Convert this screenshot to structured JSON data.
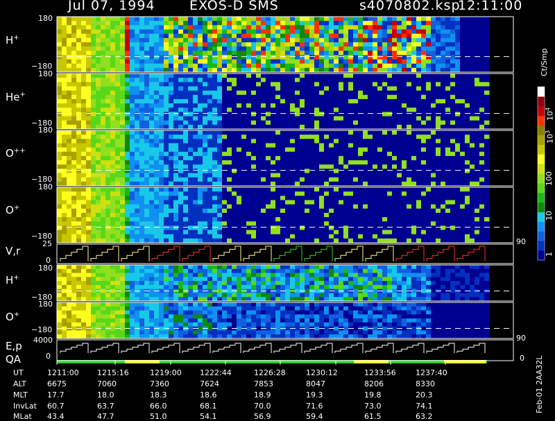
{
  "header": {
    "date": "Jul 07, 1994",
    "instrument": "EXOS-D SMS",
    "file": "s4070802.ksp",
    "time": "12:11:00"
  },
  "colors": {
    "palette": [
      "#000090",
      "#0030c0",
      "#1060e0",
      "#1090f0",
      "#18c8e8",
      "#108808",
      "#18b818",
      "#58d818",
      "#90e020",
      "#d0e010",
      "#ffff20",
      "#c8c800",
      "#a8a000",
      "#888000",
      "#ff3000",
      "#c80000",
      "#900010",
      "#ffffff"
    ]
  },
  "panels": [
    {
      "id": "H+",
      "base": "H",
      "sup": "+",
      "ytop": "180",
      "ybot": "−180"
    },
    {
      "id": "He+",
      "base": "He",
      "sup": "+",
      "ytop": "180",
      "ybot": "−180"
    },
    {
      "id": "O++",
      "base": "O",
      "sup": "++",
      "ytop": "180",
      "ybot": "−180"
    },
    {
      "id": "O+",
      "base": "O",
      "sup": "+",
      "ytop": "180",
      "ybot": "−180"
    },
    {
      "id": "Vr",
      "label": "V,r",
      "ytop": "25",
      "ybot": "0",
      "right": "90"
    },
    {
      "id": "H+2",
      "base": "H",
      "sup": "+",
      "ytop": "180",
      "ybot": "−180"
    },
    {
      "id": "O+2",
      "base": "O",
      "sup": "+",
      "ytop": "180",
      "ybot": "−180"
    },
    {
      "id": "Ep",
      "label": "E,p",
      "ytop": "4000",
      "ybot": "0",
      "right_top": "90",
      "right_bot": "0"
    }
  ],
  "qa_label": "QA",
  "colorbar": {
    "unit": "Ct/Smp",
    "tick_1e4_base": "10",
    "tick_1e4_exp": "4",
    "tick_1e3_base": "10",
    "tick_1e3_exp": "3",
    "tick_100": "100",
    "tick_10": "10",
    "tick_1": "1"
  },
  "footer": {
    "rows": [
      {
        "label": "UT",
        "values": [
          "1211:00",
          "1215:16",
          "1219:00",
          "1222:44",
          "1226:28",
          "1230:12",
          "1233:56",
          "1237:40"
        ]
      },
      {
        "label": "ALT",
        "values": [
          "6675",
          "7060",
          "7360",
          "7624",
          "7853",
          "8047",
          "8206",
          "8330"
        ]
      },
      {
        "label": "MLT",
        "values": [
          "17.7",
          "18.0",
          "18.3",
          "18.6",
          "18.9",
          "19.3",
          "19.8",
          "20.3"
        ]
      },
      {
        "label": "InvLat",
        "values": [
          "60.7",
          "63.7",
          "66.0",
          "68.1",
          "70.0",
          "71.6",
          "73.0",
          "74.1"
        ]
      },
      {
        "label": "MLat",
        "values": [
          "43.4",
          "47.7",
          "51.0",
          "54.1",
          "56.9",
          "59.4",
          "61.5",
          "63.2"
        ]
      }
    ],
    "code": "Feb-01 2AA32L"
  },
  "chart_data": {
    "type": "heatmap",
    "title": "Jul 07, 1994   EXOS-D SMS",
    "xlabel": "UT",
    "x_ticks": [
      "1211:00",
      "1215:16",
      "1219:00",
      "1222:44",
      "1226:28",
      "1230:12",
      "1233:56",
      "1237:40"
    ],
    "ylim_angle": [
      -180,
      180
    ],
    "ylim_vr": [
      0,
      25
    ],
    "ylim_ep": [
      0,
      4000
    ],
    "color_scale": "log",
    "color_range": [
      1,
      10000
    ],
    "color_unit": "Ct/Smp",
    "series": [
      {
        "name": "H+",
        "kind": "angle-spectrogram"
      },
      {
        "name": "He+",
        "kind": "angle-spectrogram"
      },
      {
        "name": "O++",
        "kind": "angle-spectrogram"
      },
      {
        "name": "O+",
        "kind": "angle-spectrogram"
      },
      {
        "name": "V,r",
        "kind": "line"
      },
      {
        "name": "H+",
        "kind": "angle-spectrogram"
      },
      {
        "name": "O+",
        "kind": "angle-spectrogram"
      },
      {
        "name": "E,p",
        "kind": "line"
      }
    ],
    "grid": false
  }
}
